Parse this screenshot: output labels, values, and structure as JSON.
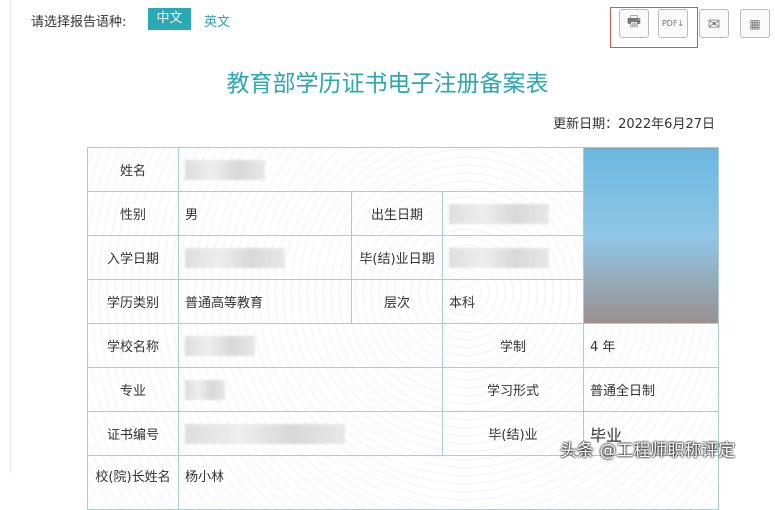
{
  "header": {
    "lang_label": "请选择报告语种:",
    "lang_zh": "中文",
    "lang_en": "英文",
    "icons": [
      "print-icon",
      "pdf-download-icon",
      "mail-icon",
      "qrcode-icon"
    ]
  },
  "title": "教育部学历证书电子注册备案表",
  "update_date": "更新日期：2022年6月27日",
  "rows": {
    "name_label": "姓名",
    "gender_label": "性别",
    "gender": "男",
    "birth_label": "出生日期",
    "enroll_label": "入学日期",
    "grad_date_label": "毕(结)业日期",
    "edu_type_label": "学历类别",
    "edu_type": "普通高等教育",
    "level_label": "层次",
    "level": "本科",
    "school_label": "学校名称",
    "duration_label": "学制",
    "duration": "4 年",
    "major_label": "专业",
    "study_form_label": "学习形式",
    "study_form": "普通全日制",
    "cert_no_label": "证书编号",
    "grad_label": "毕(结)业",
    "grad": "毕业",
    "president_label": "校(院)长姓名",
    "president": "杨小林"
  },
  "watermark": "头条 @工程师职称评定"
}
